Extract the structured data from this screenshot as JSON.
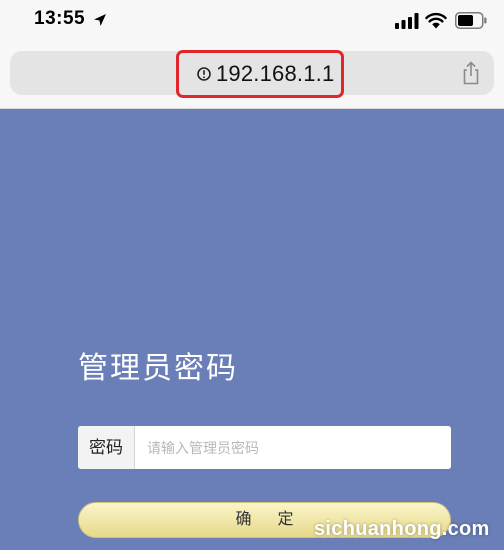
{
  "status_bar": {
    "time": "13:55",
    "icons": [
      "location-arrow-icon",
      "signal-icon",
      "wifi-icon",
      "battery-icon"
    ]
  },
  "address_bar": {
    "url": "192.168.1.1",
    "highlight_color": "#e0262a",
    "icons": [
      "info-icon",
      "share-icon"
    ]
  },
  "login": {
    "title": "管理员密码",
    "password_label": "密码",
    "password_placeholder": "请输入管理员密码",
    "confirm_label": "确定"
  },
  "watermark": "sichuanhong.com",
  "colors": {
    "page_background": "#6a7fb7",
    "button_fill": "#f3ebb0",
    "browser_chrome": "#f7f7f7"
  }
}
